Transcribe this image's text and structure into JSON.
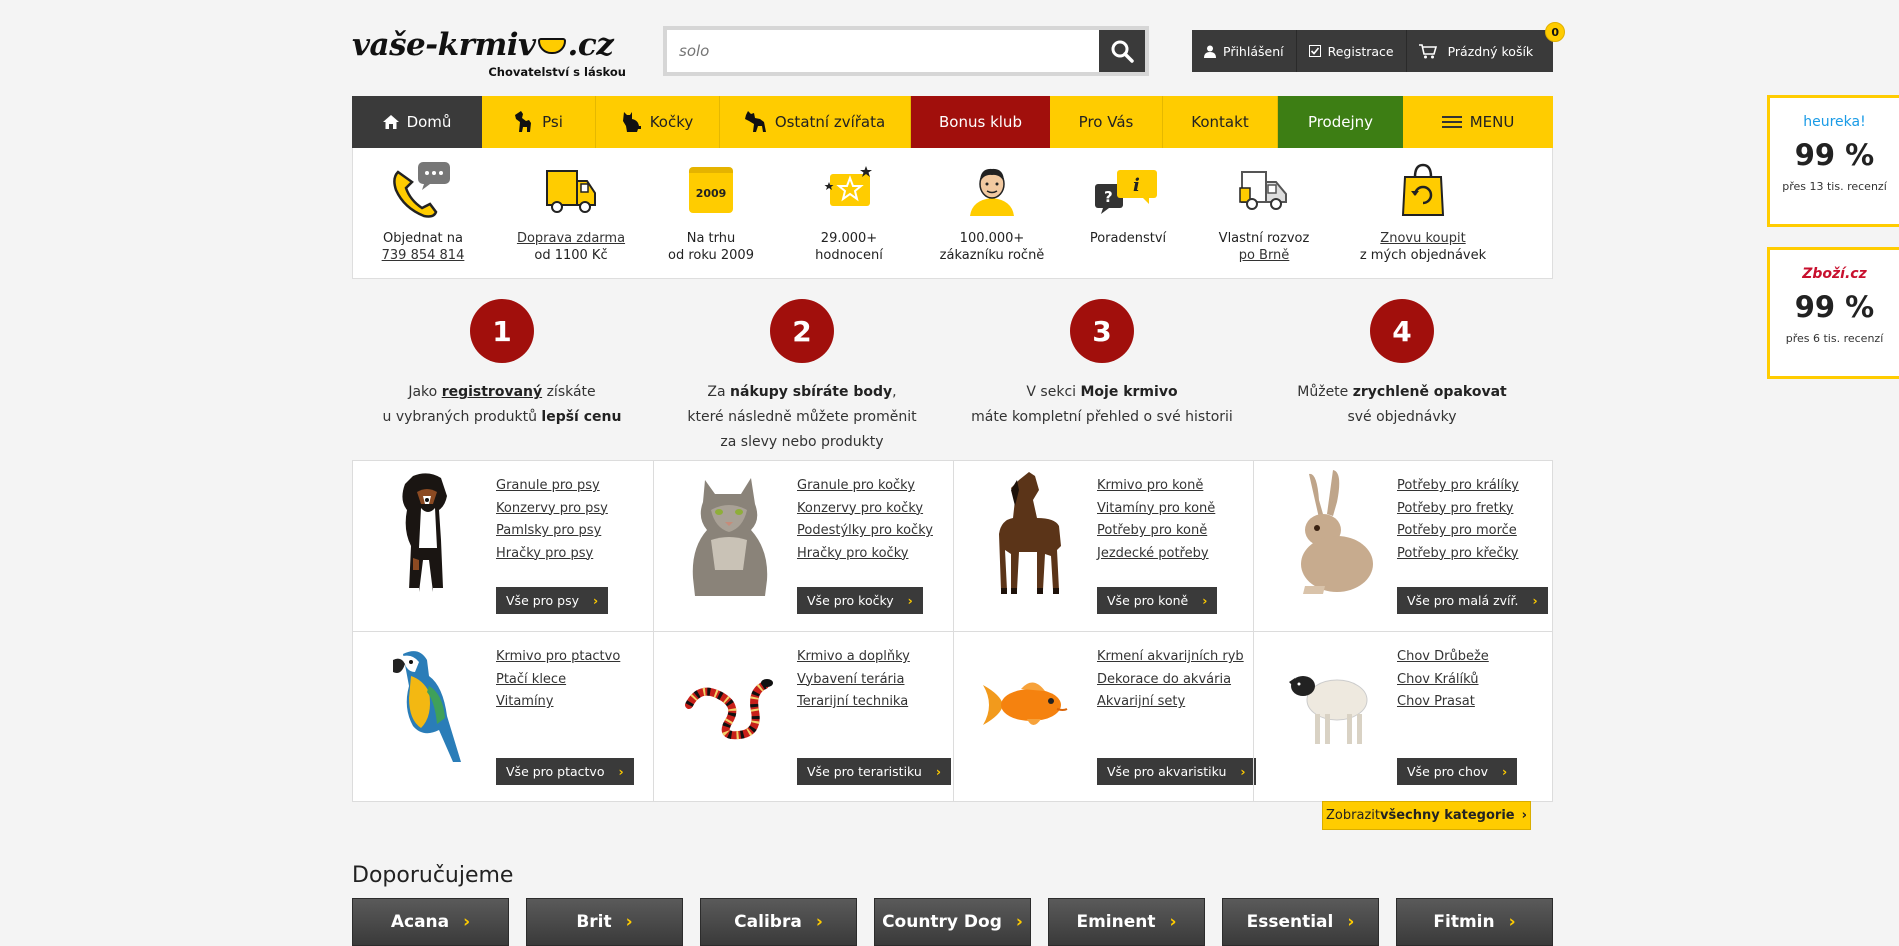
{
  "header": {
    "logo_text": "vaše-krmivo.cz",
    "logo_tagline": "Chovatelství s láskou",
    "search": {
      "value": "",
      "placeholder": "solo"
    },
    "login_label": "Přihlášení",
    "register_label": "Registrace",
    "cart_label": "Prázdný košík",
    "cart_count": "0"
  },
  "nav": [
    {
      "label": "Domů",
      "icon": "home-icon"
    },
    {
      "label": "Psi",
      "icon": "dog-icon"
    },
    {
      "label": "Kočky",
      "icon": "cat-icon"
    },
    {
      "label": "Ostatní zvířata",
      "icon": "horse-icon"
    },
    {
      "label": "Bonus klub"
    },
    {
      "label": "Pro Vás"
    },
    {
      "label": "Kontakt"
    },
    {
      "label": "Prodejny"
    },
    {
      "label": "MENU",
      "icon": "hamburger-icon"
    }
  ],
  "benefits": [
    {
      "line1": "Objednat na",
      "line2": "739 854 814",
      "icon": "phone-icon"
    },
    {
      "line1": "Doprava zdarma",
      "line2": "od 1100 Kč",
      "icon": "free-delivery-truck-icon"
    },
    {
      "line1": "Na trhu",
      "line2": "od roku 2009",
      "icon": "calendar-icon",
      "icon_text": "2009"
    },
    {
      "line1": "29.000+",
      "line2": "hodnocení",
      "icon": "rating-stars-icon"
    },
    {
      "line1": "100.000+",
      "line2": "zákazníku ročně",
      "icon": "customer-icon"
    },
    {
      "line1": "Poradenství",
      "line2": "",
      "icon": "advice-icon"
    },
    {
      "line1": "Vlastní rozvoz",
      "line2": "po Brně",
      "icon": "delivery-van-icon"
    },
    {
      "line1": "Znovu koupit",
      "line2": "z mých objednávek",
      "icon": "reorder-bag-icon"
    }
  ],
  "steps": [
    {
      "num": "1",
      "a1": "Jako ",
      "b1": "registrovaný",
      "a2": " získáte",
      "a3": "u vybraných produktů ",
      "b2": "lepší cenu",
      "a4": ""
    },
    {
      "num": "2",
      "a1": "Za ",
      "b1": "nákupy sbíráte body",
      "a2": ",",
      "a3": "které následně můžete proměnit",
      "b2": "",
      "a4": "za slevy nebo produkty"
    },
    {
      "num": "3",
      "a1": "V sekci ",
      "b1": "Moje krmivo",
      "a2": "",
      "a3": "máte kompletní přehled o své historii",
      "b2": "",
      "a4": ""
    },
    {
      "num": "4",
      "a1": "Můžete ",
      "b1": "zrychleně opakovat",
      "a2": "",
      "a3": "své objednávky",
      "b2": "",
      "a4": ""
    }
  ],
  "categories": [
    {
      "image": "dog-image",
      "links": [
        "Granule pro psy",
        "Konzervy pro psy",
        "Pamlsky pro psy",
        "Hračky pro psy"
      ],
      "button": "Vše pro psy"
    },
    {
      "image": "cat-image",
      "links": [
        "Granule pro kočky",
        "Konzervy pro kočky",
        "Podestýlky pro kočky",
        "Hračky pro kočky"
      ],
      "button": "Vše pro kočky"
    },
    {
      "image": "horse-image",
      "links": [
        "Krmivo pro koně",
        "Vitamíny pro koně",
        "Potřeby pro koně",
        "Jezdecké potřeby"
      ],
      "button": "Vše pro koně"
    },
    {
      "image": "rabbit-image",
      "links": [
        "Potřeby pro králíky",
        "Potřeby pro fretky",
        "Potřeby pro morče",
        "Potřeby pro křečky"
      ],
      "button": "Vše pro malá zvíř."
    },
    {
      "image": "parrot-image",
      "links": [
        "Krmivo pro ptactvo",
        "Ptačí klece",
        "Vitamíny"
      ],
      "button": "Vše pro ptactvo"
    },
    {
      "image": "snake-image",
      "links": [
        "Krmivo a doplňky",
        "Vybavení terária",
        "Terarijní technika"
      ],
      "button": "Vše pro teraristiku"
    },
    {
      "image": "goldfish-image",
      "links": [
        "Krmení akvarijních ryb",
        "Dekorace do akvária",
        "Akvarijní sety"
      ],
      "button": "Vše pro akvaristiku"
    },
    {
      "image": "sheep-image",
      "links": [
        "Chov Drůbeže",
        "Chov Králíků",
        "Chov Prasat"
      ],
      "button": "Vše pro chov"
    }
  ],
  "all_categories": {
    "prefix": "Zobrazit ",
    "bold": "všechny kategorie"
  },
  "recommended": {
    "title": "Doporučujeme",
    "brands": [
      "Acana",
      "Brit",
      "Calibra",
      "Country Dog",
      "Eminent",
      "Essential",
      "Fitmin"
    ]
  },
  "ratings": [
    {
      "brand": "heureka!",
      "percent": "99 %",
      "sub": "přes 13 tis. recenzí",
      "color": "#1a9be6"
    },
    {
      "brand": "Zboží.cz",
      "percent": "99 %",
      "sub": "přes 6 tis. recenzí",
      "color": "#c8102e"
    }
  ],
  "colors": {
    "yellow": "#ffcc00",
    "dark": "#3a3a3a",
    "red": "#a10f0c",
    "green": "#3d7e14"
  }
}
